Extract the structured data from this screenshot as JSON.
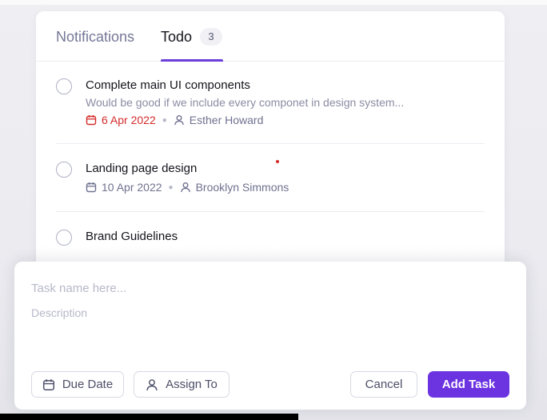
{
  "tabs": {
    "notifications_label": "Notifications",
    "todo_label": "Todo",
    "todo_count": "3"
  },
  "tasks": [
    {
      "title": "Complete main UI components",
      "description": "Would be good if we include every componet in design system...",
      "date": "6 Apr 2022",
      "date_overdue": true,
      "assignee": "Esther Howard"
    },
    {
      "title": "Landing page design",
      "description": "",
      "date": "10 Apr 2022",
      "date_overdue": false,
      "assignee": "Brooklyn Simmons"
    },
    {
      "title": "Brand Guidelines",
      "description": "",
      "date": "",
      "date_overdue": false,
      "assignee": ""
    }
  ],
  "form": {
    "name_placeholder": "Task name here...",
    "description_placeholder": "Description",
    "due_date_label": "Due Date",
    "assign_to_label": "Assign To",
    "cancel_label": "Cancel",
    "add_task_label": "Add Task"
  },
  "colors": {
    "accent": "#6c33e0",
    "overdue": "#d42a2a",
    "muted": "#6f7290"
  },
  "icons": {
    "date": "calendar-icon",
    "assignee": "user-icon"
  }
}
